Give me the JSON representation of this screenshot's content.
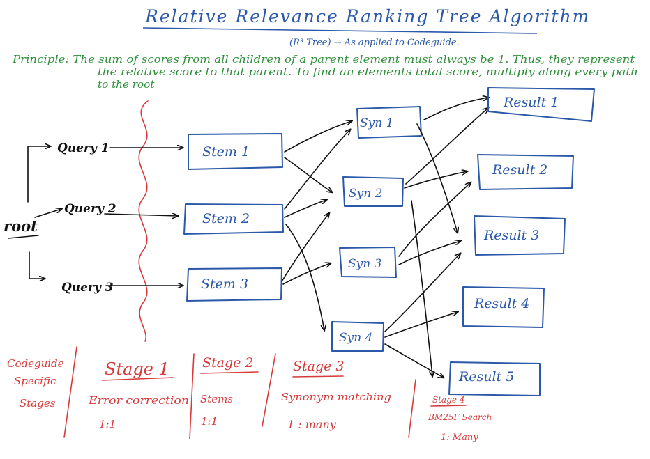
{
  "title": "Relative Relevance Ranking Tree Algorithm",
  "subtitle": "(R³ Tree) → As applied to Codeguide.",
  "principle": {
    "line1": "Principle: The sum of scores from all children of a parent element must always be 1. Thus, they represent",
    "line2": "the relative score to that parent. To find an elements total score, multiply along every path",
    "line3": "to the root"
  },
  "root_label": "root",
  "queries": [
    "Query 1",
    "Query 2",
    "Query 3"
  ],
  "stems": [
    "Stem 1",
    "Stem 2",
    "Stem 3"
  ],
  "synonyms": [
    "Syn 1",
    "Syn 2",
    "Syn 3",
    "Syn 4"
  ],
  "results": [
    "Result 1",
    "Result 2",
    "Result 3",
    "Result 4",
    "Result 5"
  ],
  "stages_header": [
    "Codeguide",
    "Specific",
    "Stages"
  ],
  "stages": [
    {
      "title": "Stage 1",
      "desc": "Error correction",
      "ratio": "1:1"
    },
    {
      "title": "Stage 2",
      "desc": "Stems",
      "ratio": "1:1"
    },
    {
      "title": "Stage 3",
      "desc": "Synonym matching",
      "ratio": "1 : many"
    },
    {
      "title": "Stage 4",
      "desc": "BM25F Search",
      "ratio": "1: Many"
    }
  ],
  "colors": {
    "title": "#2b58a8",
    "principle": "#2f8f3a",
    "boxes": "#2b58a8",
    "arrows": "#111111",
    "stages": "#d63a3a"
  }
}
